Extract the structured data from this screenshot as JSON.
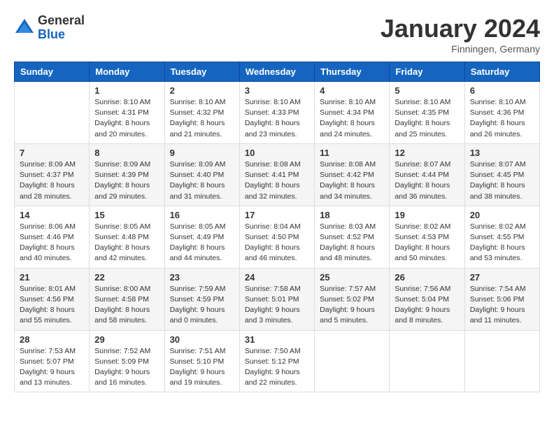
{
  "logo": {
    "general": "General",
    "blue": "Blue"
  },
  "title": "January 2024",
  "location": "Finningen, Germany",
  "days_header": [
    "Sunday",
    "Monday",
    "Tuesday",
    "Wednesday",
    "Thursday",
    "Friday",
    "Saturday"
  ],
  "weeks": [
    [
      {
        "num": "",
        "info": ""
      },
      {
        "num": "1",
        "info": "Sunrise: 8:10 AM\nSunset: 4:31 PM\nDaylight: 8 hours\nand 20 minutes."
      },
      {
        "num": "2",
        "info": "Sunrise: 8:10 AM\nSunset: 4:32 PM\nDaylight: 8 hours\nand 21 minutes."
      },
      {
        "num": "3",
        "info": "Sunrise: 8:10 AM\nSunset: 4:33 PM\nDaylight: 8 hours\nand 23 minutes."
      },
      {
        "num": "4",
        "info": "Sunrise: 8:10 AM\nSunset: 4:34 PM\nDaylight: 8 hours\nand 24 minutes."
      },
      {
        "num": "5",
        "info": "Sunrise: 8:10 AM\nSunset: 4:35 PM\nDaylight: 8 hours\nand 25 minutes."
      },
      {
        "num": "6",
        "info": "Sunrise: 8:10 AM\nSunset: 4:36 PM\nDaylight: 8 hours\nand 26 minutes."
      }
    ],
    [
      {
        "num": "7",
        "info": "Sunrise: 8:09 AM\nSunset: 4:37 PM\nDaylight: 8 hours\nand 28 minutes."
      },
      {
        "num": "8",
        "info": "Sunrise: 8:09 AM\nSunset: 4:39 PM\nDaylight: 8 hours\nand 29 minutes."
      },
      {
        "num": "9",
        "info": "Sunrise: 8:09 AM\nSunset: 4:40 PM\nDaylight: 8 hours\nand 31 minutes."
      },
      {
        "num": "10",
        "info": "Sunrise: 8:08 AM\nSunset: 4:41 PM\nDaylight: 8 hours\nand 32 minutes."
      },
      {
        "num": "11",
        "info": "Sunrise: 8:08 AM\nSunset: 4:42 PM\nDaylight: 8 hours\nand 34 minutes."
      },
      {
        "num": "12",
        "info": "Sunrise: 8:07 AM\nSunset: 4:44 PM\nDaylight: 8 hours\nand 36 minutes."
      },
      {
        "num": "13",
        "info": "Sunrise: 8:07 AM\nSunset: 4:45 PM\nDaylight: 8 hours\nand 38 minutes."
      }
    ],
    [
      {
        "num": "14",
        "info": "Sunrise: 8:06 AM\nSunset: 4:46 PM\nDaylight: 8 hours\nand 40 minutes."
      },
      {
        "num": "15",
        "info": "Sunrise: 8:05 AM\nSunset: 4:48 PM\nDaylight: 8 hours\nand 42 minutes."
      },
      {
        "num": "16",
        "info": "Sunrise: 8:05 AM\nSunset: 4:49 PM\nDaylight: 8 hours\nand 44 minutes."
      },
      {
        "num": "17",
        "info": "Sunrise: 8:04 AM\nSunset: 4:50 PM\nDaylight: 8 hours\nand 46 minutes."
      },
      {
        "num": "18",
        "info": "Sunrise: 8:03 AM\nSunset: 4:52 PM\nDaylight: 8 hours\nand 48 minutes."
      },
      {
        "num": "19",
        "info": "Sunrise: 8:02 AM\nSunset: 4:53 PM\nDaylight: 8 hours\nand 50 minutes."
      },
      {
        "num": "20",
        "info": "Sunrise: 8:02 AM\nSunset: 4:55 PM\nDaylight: 8 hours\nand 53 minutes."
      }
    ],
    [
      {
        "num": "21",
        "info": "Sunrise: 8:01 AM\nSunset: 4:56 PM\nDaylight: 8 hours\nand 55 minutes."
      },
      {
        "num": "22",
        "info": "Sunrise: 8:00 AM\nSunset: 4:58 PM\nDaylight: 8 hours\nand 58 minutes."
      },
      {
        "num": "23",
        "info": "Sunrise: 7:59 AM\nSunset: 4:59 PM\nDaylight: 9 hours\nand 0 minutes."
      },
      {
        "num": "24",
        "info": "Sunrise: 7:58 AM\nSunset: 5:01 PM\nDaylight: 9 hours\nand 3 minutes."
      },
      {
        "num": "25",
        "info": "Sunrise: 7:57 AM\nSunset: 5:02 PM\nDaylight: 9 hours\nand 5 minutes."
      },
      {
        "num": "26",
        "info": "Sunrise: 7:56 AM\nSunset: 5:04 PM\nDaylight: 9 hours\nand 8 minutes."
      },
      {
        "num": "27",
        "info": "Sunrise: 7:54 AM\nSunset: 5:06 PM\nDaylight: 9 hours\nand 11 minutes."
      }
    ],
    [
      {
        "num": "28",
        "info": "Sunrise: 7:53 AM\nSunset: 5:07 PM\nDaylight: 9 hours\nand 13 minutes."
      },
      {
        "num": "29",
        "info": "Sunrise: 7:52 AM\nSunset: 5:09 PM\nDaylight: 9 hours\nand 16 minutes."
      },
      {
        "num": "30",
        "info": "Sunrise: 7:51 AM\nSunset: 5:10 PM\nDaylight: 9 hours\nand 19 minutes."
      },
      {
        "num": "31",
        "info": "Sunrise: 7:50 AM\nSunset: 5:12 PM\nDaylight: 9 hours\nand 22 minutes."
      },
      {
        "num": "",
        "info": ""
      },
      {
        "num": "",
        "info": ""
      },
      {
        "num": "",
        "info": ""
      }
    ]
  ]
}
